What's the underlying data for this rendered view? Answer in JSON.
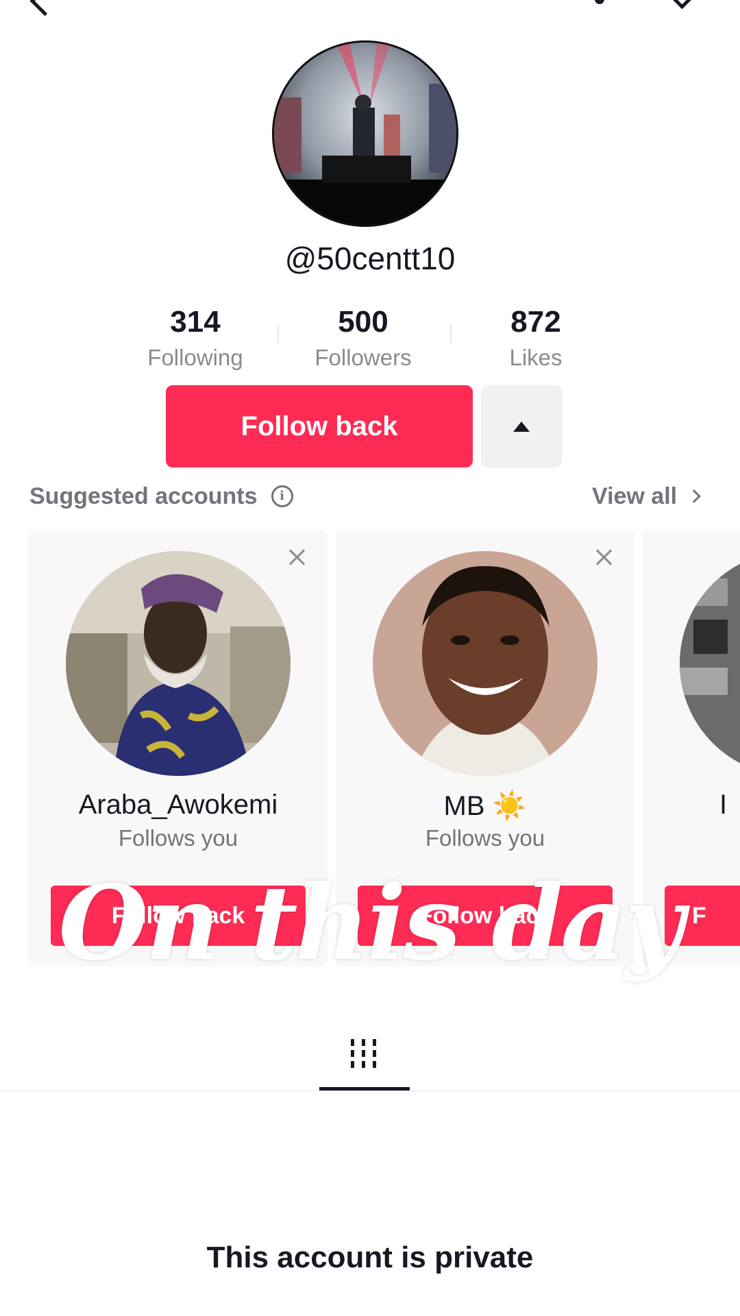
{
  "profile": {
    "username": "@50centt10",
    "stats": [
      {
        "value": "314",
        "label": "Following"
      },
      {
        "value": "500",
        "label": "Followers"
      },
      {
        "value": "872",
        "label": "Likes"
      }
    ],
    "follow_button": "Follow back"
  },
  "suggested": {
    "title": "Suggested accounts",
    "info_icon": "i",
    "view_all": "View all",
    "cards": [
      {
        "name": "Araba_Awokemi",
        "subtitle": "Follows you",
        "button": "Follow back"
      },
      {
        "name": "MB ☀️",
        "subtitle": "Follows you",
        "button": "Follow back"
      },
      {
        "name": "I",
        "subtitle": "",
        "button": "F"
      }
    ]
  },
  "overlay_text": "On this day",
  "tabs": {
    "active_icon": "grid-icon"
  },
  "private_message": "This account is private",
  "colors": {
    "accent": "#fe2c55",
    "text": "#161823",
    "muted": "#8a8b91"
  }
}
